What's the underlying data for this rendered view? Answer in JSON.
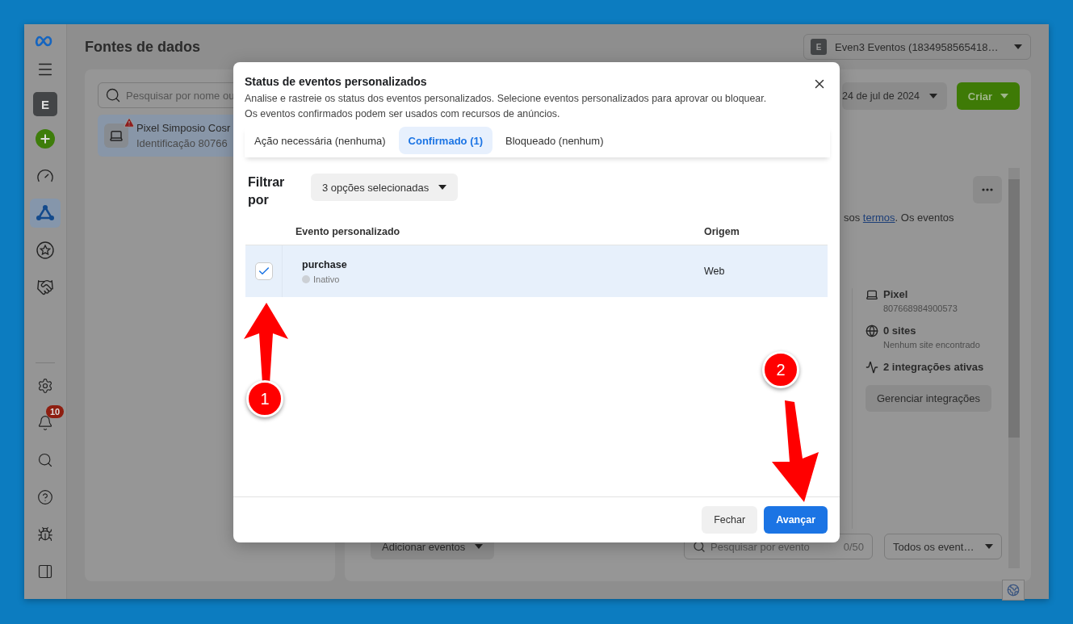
{
  "sidebar": {
    "account_initial": "E",
    "nav_items": [
      {
        "kind": "gauge",
        "selected": false
      },
      {
        "kind": "network",
        "selected": true
      },
      {
        "kind": "star",
        "selected": false
      },
      {
        "kind": "handshake",
        "selected": false
      }
    ],
    "tools": [
      {
        "kind": "settings"
      },
      {
        "kind": "notifications",
        "badge": "10"
      },
      {
        "kind": "search"
      },
      {
        "kind": "help"
      },
      {
        "kind": "bug"
      },
      {
        "kind": "panel"
      }
    ]
  },
  "header": {
    "title": "Fontes de dados",
    "account": {
      "initial": "E",
      "label": "Even3 Eventos (1834958565418…"
    }
  },
  "sources_panel": {
    "search_placeholder": "Pesquisar por nome ou",
    "items": [
      {
        "name": "Pixel Simposio Cosr",
        "id": "Identificação 80766",
        "selected": true,
        "warning": true
      }
    ]
  },
  "details_panel": {
    "date_range": "24 de jul de 2024",
    "create_button": "Criar",
    "terms": {
      "before": "sos ",
      "link": "termos",
      "after": ". Os eventos"
    },
    "info": [
      {
        "kind": "pixel",
        "title": "Pixel",
        "subtitle": "807668984900573"
      },
      {
        "kind": "sites",
        "title": "0 sites",
        "subtitle": "Nenhum site encontrado"
      },
      {
        "kind": "integrations",
        "title": "2 integrações ativas"
      }
    ],
    "manage_button": "Gerenciar integrações",
    "add_events_button": "Adicionar eventos",
    "event_search": {
      "placeholder": "Pesquisar por evento",
      "count": "0/50"
    },
    "event_filter": "Todos os event…"
  },
  "dialog": {
    "title": "Status de eventos personalizados",
    "description": "Analise e rastreie os status dos eventos personalizados. Selecione eventos personalizados para aprovar ou bloquear. Os eventos confirmados podem ser usados com recursos de anúncios.",
    "tabs": [
      {
        "label": "Ação necessária (nenhuma)",
        "selected": false
      },
      {
        "label": "Confirmado (1)",
        "selected": true
      },
      {
        "label": "Bloqueado (nenhum)",
        "selected": false
      }
    ],
    "filter_label": "Filtrar por",
    "filter_dropdown": "3 opções selecionadas",
    "columns": [
      "Evento personalizado",
      "Origem"
    ],
    "rows": [
      {
        "name": "purchase",
        "status": "Inativo",
        "origin": "Web",
        "checked": true,
        "selected": true
      }
    ],
    "buttons": [
      {
        "label": "Fechar",
        "kind": "secondary"
      },
      {
        "label": "Avançar",
        "kind": "primary"
      }
    ]
  },
  "annotations": [
    {
      "number": "1"
    },
    {
      "number": "2"
    }
  ]
}
